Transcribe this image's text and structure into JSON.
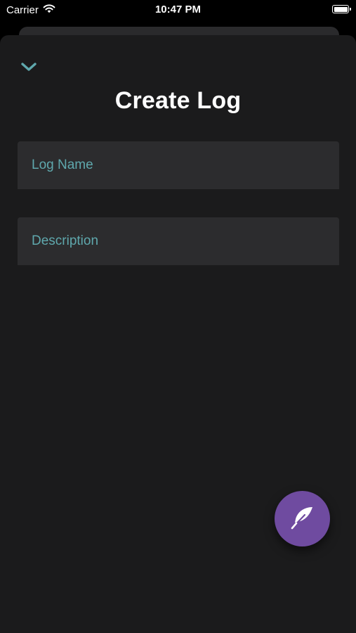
{
  "status_bar": {
    "carrier": "Carrier",
    "time": "10:47 PM",
    "battery_level": 1.0
  },
  "sheet": {
    "dismiss_icon": "chevron-down-icon",
    "title": "Create Log"
  },
  "form": {
    "log_name": {
      "placeholder": "Log Name",
      "value": ""
    },
    "description": {
      "placeholder": "Description",
      "value": ""
    }
  },
  "fab": {
    "icon": "feather-icon"
  },
  "colors": {
    "background": "#000000",
    "sheet": "#1b1b1c",
    "field": "#2c2c2e",
    "accent_teal": "#5fa8ad",
    "fab_purple": "#6f4ba0",
    "text": "#ffffff"
  }
}
